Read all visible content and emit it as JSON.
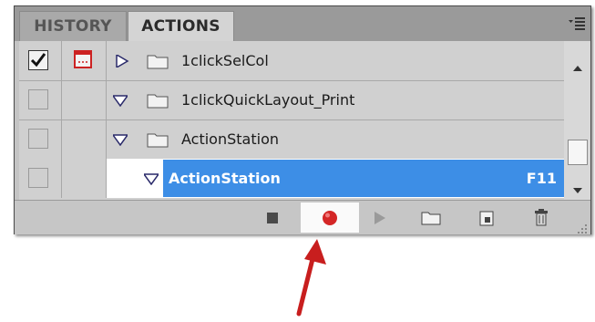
{
  "tabs": [
    {
      "label": "HISTORY"
    },
    {
      "label": "ACTIONS"
    }
  ],
  "rows": [
    {
      "name": "1clickSelCol",
      "checked": true,
      "dialog_toggle": true,
      "expanded": false
    },
    {
      "name": "1clickQuickLayout_Print",
      "checked": false,
      "dialog_toggle": false,
      "expanded": true
    },
    {
      "name": "ActionStation",
      "checked": false,
      "dialog_toggle": false,
      "expanded": true
    },
    {
      "name": "ActionStation",
      "checked": false,
      "dialog_toggle": false,
      "expanded": true,
      "selected": true,
      "shortcut": "F11"
    }
  ],
  "toolbar": [
    "stop-icon",
    "record-icon",
    "play-icon",
    "new-set-icon",
    "new-action-icon",
    "delete-icon"
  ],
  "colors": {
    "selection": "#3d8ee6",
    "record": "#d42626",
    "arrow": "#c81e1e",
    "dialog": "#cc2222"
  }
}
